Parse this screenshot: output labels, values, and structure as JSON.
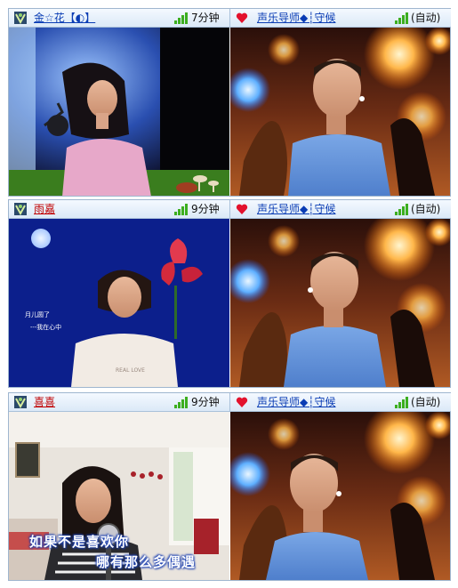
{
  "rows": [
    {
      "left_user": "金☆花【◐】",
      "left_signal": "7分钟",
      "right_user": "声乐导师◆┆守候",
      "right_status": "(自动)"
    },
    {
      "left_user": "雨嘉",
      "left_signal": "9分钟",
      "right_user": "声乐导师◆┆守候",
      "right_status": "(自动)"
    },
    {
      "left_user": "喜喜",
      "left_signal": "9分钟",
      "right_user": "声乐导师◆┆守候",
      "right_status": "(自动)"
    }
  ],
  "video2": {
    "poem_line1": "月儿圆了",
    "poem_line2": "---我在心中"
  },
  "video3": {
    "caption_line1": "如果不是喜欢你",
    "caption_line2": "哪有那么多偶遇"
  },
  "colors": {
    "header_top": "#f4f9ff",
    "header_bottom": "#dbe9f7",
    "name_red": "#c00000",
    "name_blue": "#0a3cb4",
    "signal_green": "#3cae1f",
    "heart": "#e3122d"
  },
  "icons": {
    "app": "v-logo-icon",
    "signal": "signal-bars-icon",
    "heart": "heart-icon"
  }
}
